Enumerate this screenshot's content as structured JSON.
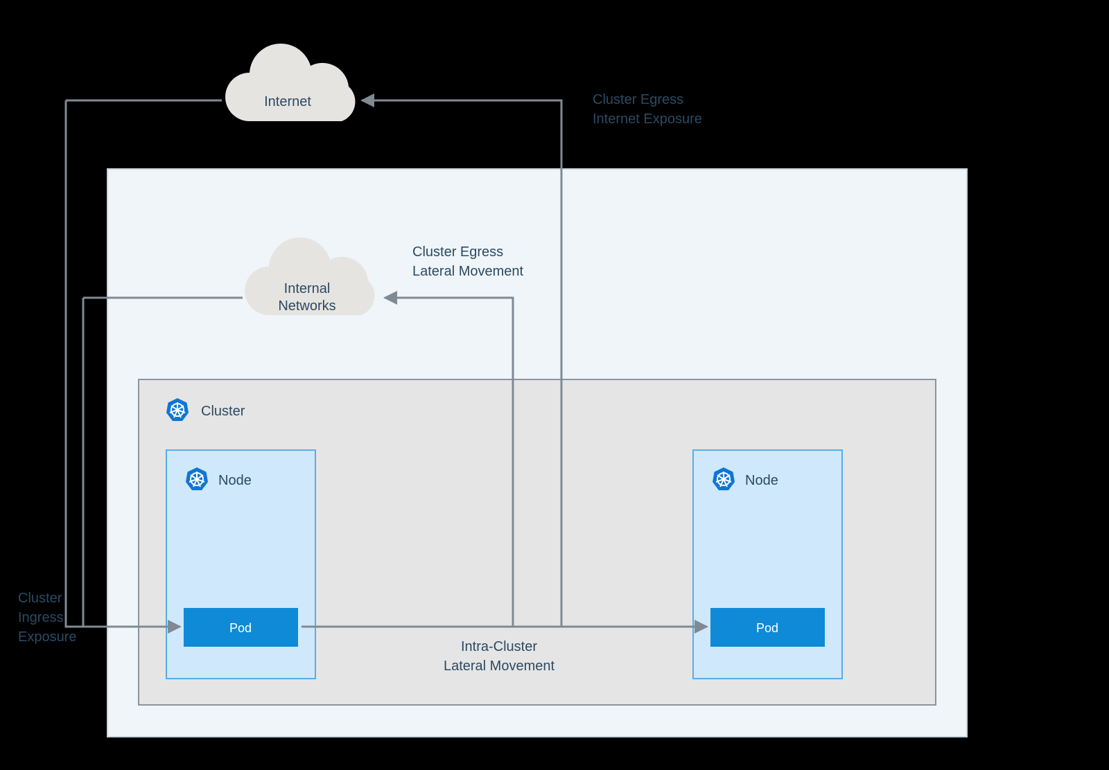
{
  "clouds": {
    "internet": "Internet",
    "internal_line1": "Internal",
    "internal_line2": "Networks"
  },
  "boxes": {
    "cluster": "Cluster",
    "node": "Node",
    "pod": "Pod"
  },
  "labels": {
    "egress_internet_l1": "Cluster Egress",
    "egress_internet_l2": "Internet Exposure",
    "egress_lateral_l1": "Cluster Egress",
    "egress_lateral_l2": "Lateral Movement",
    "intra_l1": "Intra-Cluster",
    "intra_l2": "Lateral Movement",
    "ingress_l1": "Cluster",
    "ingress_l2": "Ingress",
    "ingress_l3": "Exposure"
  },
  "colors": {
    "outer_fill": "#eff5f8",
    "outer_stroke": "#c7d3dc",
    "cluster_fill": "#e5e5e5",
    "cluster_stroke": "#8a949e",
    "node_fill": "#cfe8fb",
    "node_stroke": "#55aee8",
    "pod_fill": "#0f8ad6",
    "cloud_fill": "#e6e4e1",
    "arrow": "#7f8a94",
    "k8s": "#1076d4"
  }
}
